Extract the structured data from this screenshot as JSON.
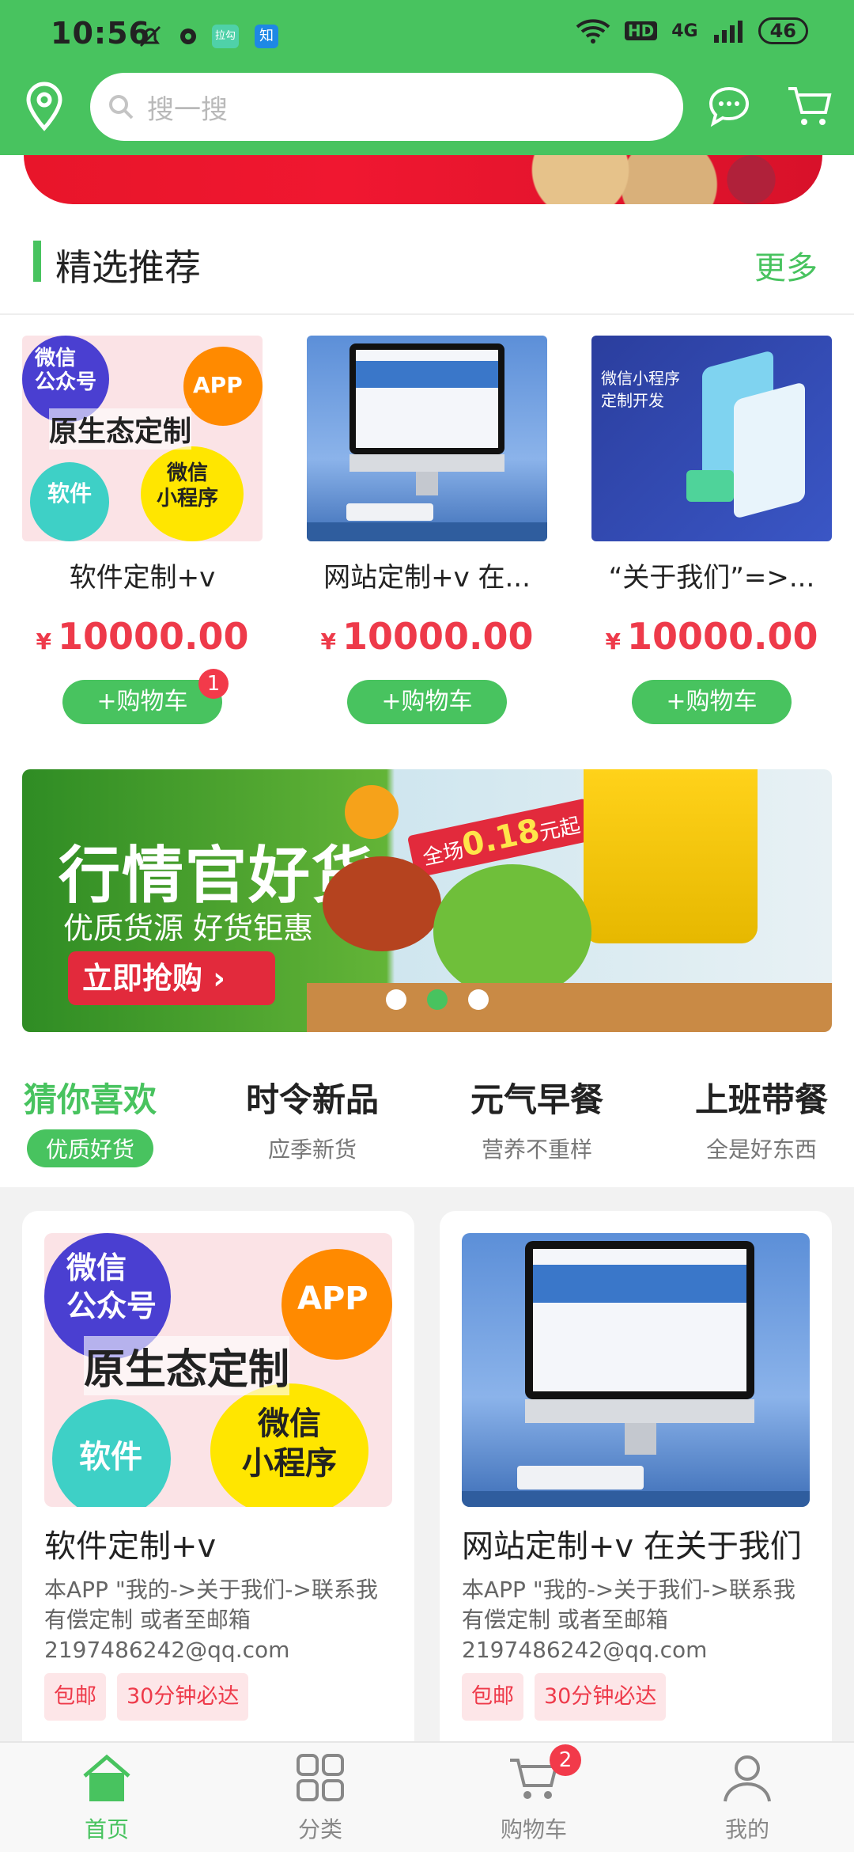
{
  "status_bar": {
    "time": "10:56",
    "network": "4G",
    "hd": "HD",
    "battery": "46",
    "app_badge_1": "拉勾",
    "app_badge_2": "知"
  },
  "search": {
    "placeholder": "搜一搜"
  },
  "section": {
    "title": "精选推荐",
    "more": "更多"
  },
  "featured": [
    {
      "name": "软件定制+v",
      "currency": "¥",
      "price": "10000.00",
      "button": "+购物车",
      "badge": "1",
      "image_text": {
        "a": "微信\n公众号",
        "b": "APP",
        "c": "原生态定制",
        "d": "软件",
        "e": "微信\n小程序"
      }
    },
    {
      "name": "网站定制+v 在...",
      "currency": "¥",
      "price": "10000.00",
      "button": "+购物车"
    },
    {
      "name": "“关于我们”=>...",
      "currency": "¥",
      "price": "10000.00",
      "button": "+购物车",
      "image_text": {
        "a": "微信小程序\n定制开发"
      }
    }
  ],
  "promo": {
    "title": "行情官好货",
    "subtitle": "优质货源  好货钜惠",
    "button": "立即抢购",
    "sale_prefix": "全场",
    "sale_value": "0.18",
    "sale_suffix": "元起"
  },
  "tabs": [
    {
      "title": "猜你喜欢",
      "sub": "优质好货"
    },
    {
      "title": "时令新品",
      "sub": "应季新货"
    },
    {
      "title": "元气早餐",
      "sub": "营养不重样"
    },
    {
      "title": "上班带餐",
      "sub": "全是好东西"
    }
  ],
  "grid": [
    {
      "name": "软件定制+v",
      "desc": "本APP \"我的->关于我们->联系我有偿定制  或者至邮箱2197486242@qq.com",
      "tags": [
        "包邮",
        "30分钟必达"
      ]
    },
    {
      "name": "网站定制+v 在关于我们",
      "desc": "本APP \"我的->关于我们->联系我有偿定制  或者至邮箱2197486242@qq.com",
      "tags": [
        "包邮",
        "30分钟必达"
      ]
    }
  ],
  "nav": [
    {
      "label": "首页",
      "icon": "home-icon"
    },
    {
      "label": "分类",
      "icon": "grid-icon"
    },
    {
      "label": "购物车",
      "icon": "cart-icon",
      "badge": "2"
    },
    {
      "label": "我的",
      "icon": "user-icon"
    }
  ],
  "colors": {
    "brand_green": "#48c35f",
    "price_red": "#ee3a4a"
  }
}
